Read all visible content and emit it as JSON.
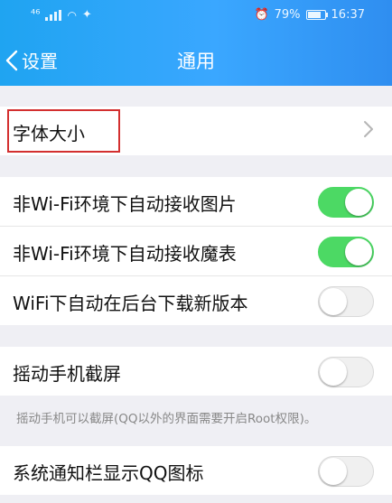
{
  "status_bar": {
    "signal": "⁴⁶",
    "battery_pct": "79%",
    "time": "16:37",
    "battery_level": 0.79
  },
  "nav": {
    "back_label": "设置",
    "title": "通用"
  },
  "sections": {
    "font": {
      "label": "字体大小"
    },
    "media": [
      {
        "label": "非Wi-Fi环境下自动接收图片",
        "on": true
      },
      {
        "label": "非Wi-Fi环境下自动接收魔表",
        "on": true
      },
      {
        "label": "WiFi下自动在后台下载新版本",
        "on": false
      }
    ],
    "shake": {
      "label": "摇动手机截屏",
      "on": false,
      "note": "摇动手机可以截屏(QQ以外的界面需要开启Root权限)。"
    },
    "notify": {
      "label": "系统通知栏显示QQ图标",
      "on": false
    }
  },
  "colors": {
    "header_start": "#1fa4f1",
    "toggle_on": "#4cd964",
    "highlight_border": "#d32f2f"
  }
}
